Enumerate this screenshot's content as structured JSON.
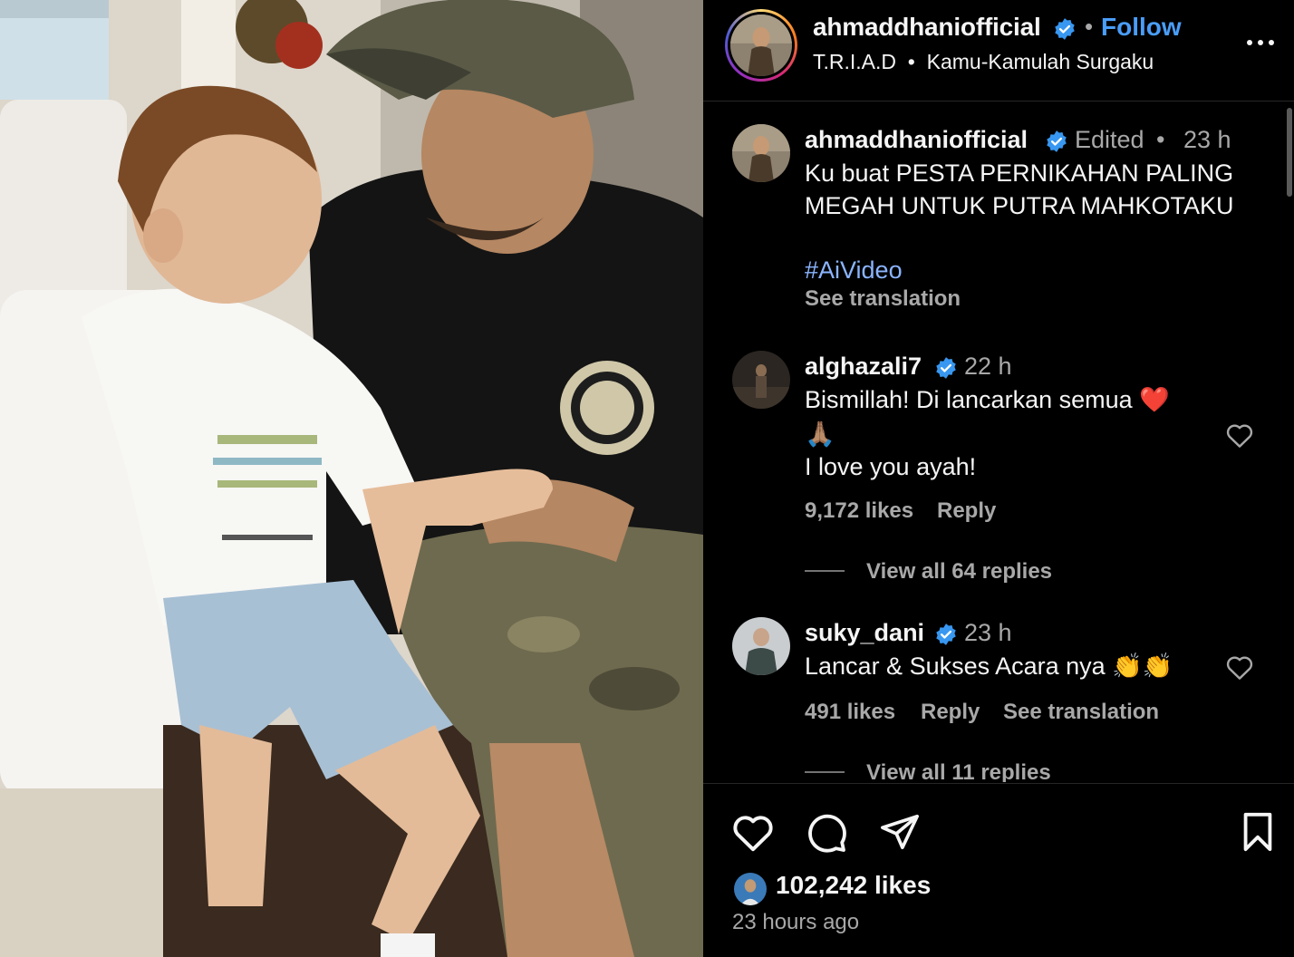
{
  "post": {
    "username": "ahmaddhaniofficial",
    "follow_label": "Follow",
    "separator": "•",
    "audio": "T.R.I.A.D  •  Kamu-Kamulah Surgaku"
  },
  "caption": {
    "username": "ahmaddhaniofficial",
    "edited": "Edited",
    "time": "23 h",
    "line1": "Ku buat PESTA PERNIKAHAN PALING",
    "line2": "MEGAH UNTUK PUTRA MAHKOTAKU",
    "hashtag": "#AiVideo",
    "see_translation": "See translation"
  },
  "comments": [
    {
      "username": "alghazali7",
      "time": "22 h",
      "line1": "Bismillah! Di lancarkan semua ❤️",
      "line2": "🙏🏽",
      "line3": "I love you ayah!",
      "likes": "9,172 likes",
      "reply": "Reply",
      "view_replies": "View all 64 replies"
    },
    {
      "username": "suky_dani",
      "time": "23 h",
      "line1": "Lancar & Sukses Acara nya 👏👏",
      "likes": "491 likes",
      "reply": "Reply",
      "see_translation": "See translation",
      "view_replies": "View all 11 replies"
    }
  ],
  "footer": {
    "likes": "102,242 likes",
    "time_ago": "23 hours ago"
  },
  "icons": {
    "verified": "verified-badge-icon",
    "heart": "heart-icon",
    "comment": "comment-icon",
    "share": "share-icon",
    "save": "bookmark-icon",
    "more": "more-options-icon"
  },
  "colors": {
    "background": "#000000",
    "link_blue": "#4a9df8",
    "hashtag": "#8bb4ff",
    "secondary_text": "#a8a8a8",
    "verified": "#3897f0"
  }
}
